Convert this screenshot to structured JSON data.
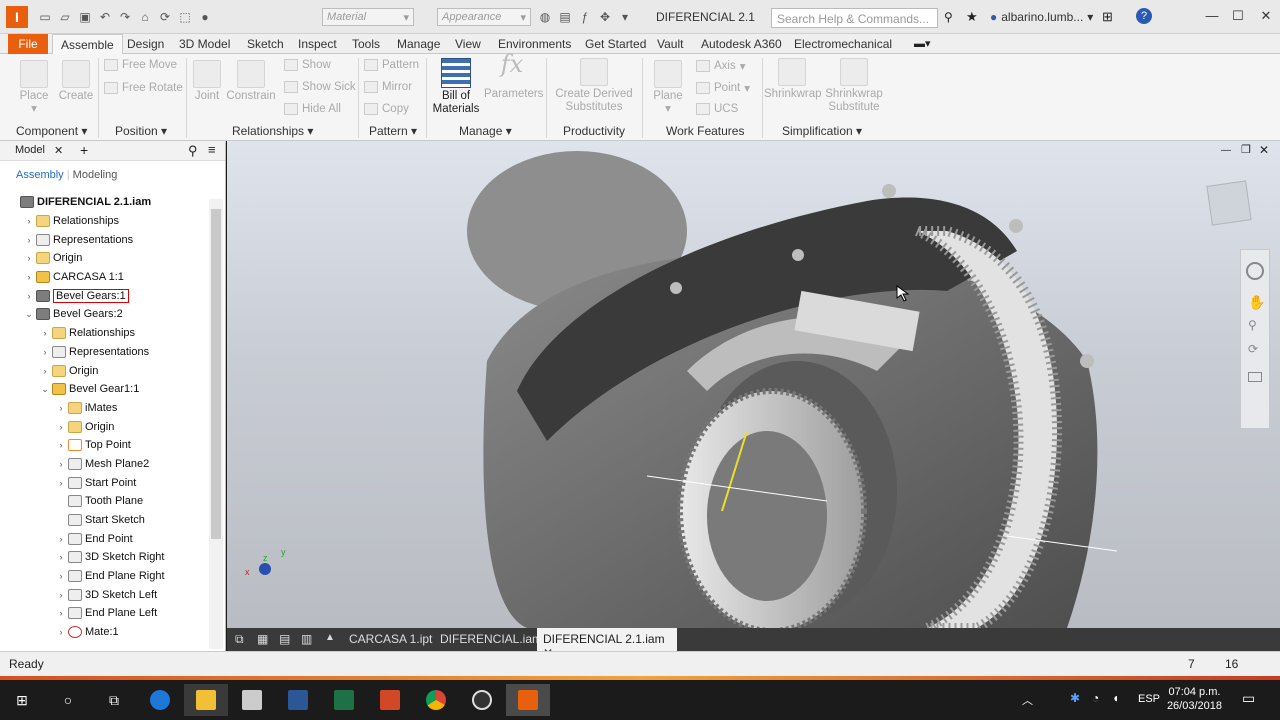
{
  "app": {
    "document_title": "DIFERENCIAL 2.1",
    "search_placeholder": "Search Help & Commands...",
    "user": "albarino.lumb...",
    "material_dd": "Material",
    "appearance_dd": "Appearance",
    "accent": "#e8600e"
  },
  "ribbon_tabs": [
    "File",
    "Assemble",
    "Design",
    "3D Model",
    "Sketch",
    "Inspect",
    "Tools",
    "Manage",
    "View",
    "Environments",
    "Get Started",
    "Vault",
    "Autodesk A360",
    "Electromechanical"
  ],
  "ribbon": {
    "place": "Place",
    "create": "Create",
    "free_move": "Free Move",
    "free_rotate": "Free Rotate",
    "joint": "Joint",
    "constrain": "Constrain",
    "show": "Show",
    "show_sick": "Show Sick",
    "hide_all": "Hide All",
    "pattern": "Pattern",
    "mirror": "Mirror",
    "copy": "Copy",
    "bill_of": "Bill of",
    "materials": "Materials",
    "parameters": "Parameters",
    "create_derived": "Create Derived",
    "substitutes": "Substitutes",
    "plane": "Plane",
    "axis": "Axis",
    "point": "Point",
    "ucs": "UCS",
    "shrinkwrap": "Shrinkwrap",
    "shrinkwrap2": "Shrinkwrap",
    "substitute": "Substitute",
    "groups": [
      "Component",
      "Position",
      "Relationships",
      "Pattern",
      "Manage",
      "Productivity",
      "Work Features",
      "Simplification"
    ]
  },
  "browser": {
    "tab": "Model",
    "subtab_assembly": "Assembly",
    "subtab_modeling": "Modeling",
    "nodes": [
      {
        "label": "DIFERENCIAL 2.1.iam",
        "tw": "",
        "icon": "asm"
      },
      {
        "label": "Relationships",
        "tw": "›",
        "icon": "folder"
      },
      {
        "label": "Representations",
        "tw": "›",
        "icon": "geom"
      },
      {
        "label": "Origin",
        "tw": "›",
        "icon": "folder"
      },
      {
        "label": "CARCASA 1:1",
        "tw": "›",
        "icon": "part"
      },
      {
        "label": "Bevel Gears:1",
        "tw": "›",
        "icon": "asm"
      },
      {
        "label": "Bevel Gears:2",
        "tw": "⌄",
        "icon": "asm"
      },
      {
        "label": "Relationships",
        "tw": "›",
        "icon": "folder"
      },
      {
        "label": "Representations",
        "tw": "›",
        "icon": "geom"
      },
      {
        "label": "Origin",
        "tw": "›",
        "icon": "folder"
      },
      {
        "label": "Bevel Gear1:1",
        "tw": "⌄",
        "icon": "part"
      },
      {
        "label": "iMates",
        "tw": "›",
        "icon": "folder"
      },
      {
        "label": "Origin",
        "tw": "›",
        "icon": "folder"
      },
      {
        "label": "Top Point",
        "tw": "›",
        "icon": "pt"
      },
      {
        "label": "Mesh Plane2",
        "tw": "›",
        "icon": "geom"
      },
      {
        "label": "Start Point",
        "tw": "›",
        "icon": "geom"
      },
      {
        "label": "Tooth Plane",
        "tw": "",
        "icon": "geom"
      },
      {
        "label": "Start Sketch",
        "tw": "",
        "icon": "geom"
      },
      {
        "label": "End Point",
        "tw": "›",
        "icon": "geom"
      },
      {
        "label": "3D Sketch Right",
        "tw": "›",
        "icon": "geom"
      },
      {
        "label": "End Plane Right",
        "tw": "›",
        "icon": "geom"
      },
      {
        "label": "3D Sketch Left",
        "tw": "›",
        "icon": "geom"
      },
      {
        "label": "End Plane Left",
        "tw": "›",
        "icon": "geom"
      },
      {
        "label": "Mate:1",
        "tw": "›",
        "icon": "mate"
      }
    ]
  },
  "doc_tabs": [
    "CARCASA 1.ipt",
    "DIFERENCIAL.iam",
    "DIFERENCIAL 2.1.iam"
  ],
  "status": {
    "text": "Ready",
    "val1": "7",
    "val2": "16"
  },
  "taskbar": {
    "lang": "ESP",
    "time": "07:04 p.m.",
    "date": "26/03/2018"
  }
}
